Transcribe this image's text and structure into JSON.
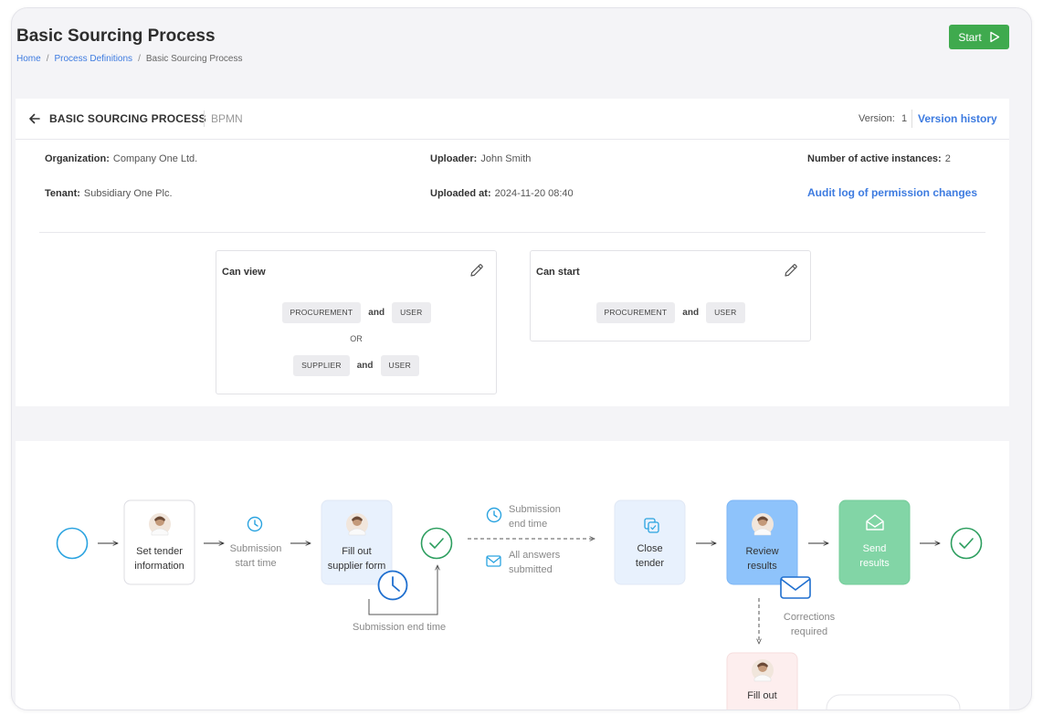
{
  "page": {
    "title": "Basic Sourcing Process",
    "breadcrumb": [
      "Home",
      "Process Definitions",
      "Basic Sourcing Process"
    ],
    "start_label": "Start"
  },
  "process": {
    "name": "BASIC SOURCING PROCESS",
    "type": "BPMN",
    "version_label": "Version:",
    "version": "1",
    "version_history_label": "Version history"
  },
  "meta": {
    "organization_label": "Organization:",
    "organization": "Company One Ltd.",
    "tenant_label": "Tenant:",
    "tenant": "Subsidiary One Plc.",
    "uploader_label": "Uploader:",
    "uploader": "John Smith",
    "uploaded_at_label": "Uploaded at:",
    "uploaded_at": "2024-11-20 08:40",
    "active_label": "Number of active instances:",
    "active": "2",
    "audit_link": "Audit log of permission changes"
  },
  "permissions": {
    "can_view": {
      "title": "Can view",
      "groups": [
        [
          "PROCUREMENT",
          "USER"
        ],
        [
          "SUPPLIER",
          "USER"
        ]
      ],
      "and": "and",
      "or": "OR"
    },
    "can_start": {
      "title": "Can start",
      "groups": [
        [
          "PROCUREMENT",
          "USER"
        ]
      ],
      "and": "and"
    }
  },
  "diagram": {
    "tasks": {
      "set_tender": [
        "Set tender",
        "information"
      ],
      "fill_supplier": [
        "Fill out",
        "supplier form"
      ],
      "close_tender": [
        "Close",
        "tender"
      ],
      "review_results": [
        "Review",
        "results"
      ],
      "send_results": [
        "Send",
        "results"
      ],
      "fill_out_bottom": [
        "Fill out"
      ]
    },
    "flows": {
      "submission_start": [
        "Submission",
        "start time"
      ],
      "submission_end_top": [
        "Submission",
        "end time"
      ],
      "all_answers": [
        "All answers",
        "submitted"
      ],
      "submission_end_loop": "Submission end time",
      "corrections": [
        "Corrections",
        "required"
      ]
    },
    "colors": {
      "event": "#2aa3e0",
      "end_event": "#2d9e5f",
      "user_task_bg": "#ffffff",
      "active_task_bg": "#e8f1fd",
      "review_bg": "#8ec3fb",
      "send_bg": "#82d5a6",
      "correction_bg": "#fdeeee"
    }
  }
}
